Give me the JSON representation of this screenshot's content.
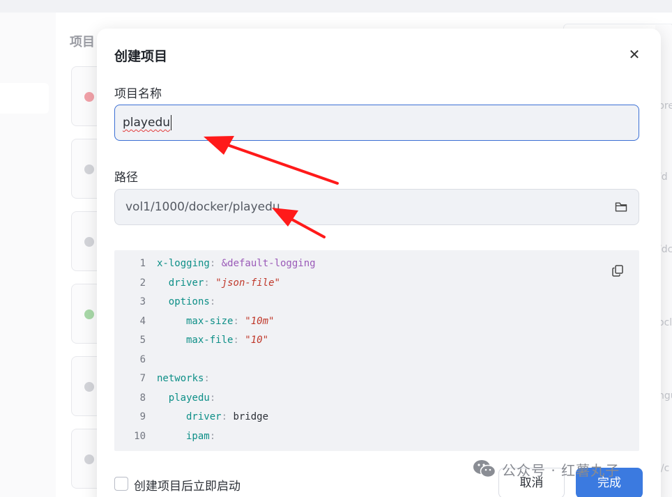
{
  "background": {
    "page_title": "项目",
    "peek_texts": [
      "pre",
      "/d",
      "/dc",
      "ocl",
      "ngu",
      "l/c"
    ]
  },
  "dialog": {
    "title": "创建项目",
    "close_icon": "close-icon",
    "name_label": "项目名称",
    "name_value": "playedu",
    "path_label": "路径",
    "path_value": "vol1/1000/docker/playedu",
    "folder_icon": "folder-icon",
    "copy_icon": "copy-icon",
    "code_lines": [
      {
        "n": "1",
        "key": "x-logging",
        "punct": ": ",
        "val": "&default-logging",
        "type": "anchor",
        "indent": 0
      },
      {
        "n": "2",
        "key": "driver",
        "punct": ": ",
        "val": "\"json-file\"",
        "type": "string",
        "indent": 2
      },
      {
        "n": "3",
        "key": "options",
        "punct": ":",
        "val": "",
        "type": "none",
        "indent": 2
      },
      {
        "n": "4",
        "key": "max-size",
        "punct": ": ",
        "val": "\"10m\"",
        "type": "string",
        "indent": 5
      },
      {
        "n": "5",
        "key": "max-file",
        "punct": ": ",
        "val": "\"10\"",
        "type": "string",
        "indent": 5
      },
      {
        "n": "6",
        "key": "",
        "punct": "",
        "val": "",
        "type": "none",
        "indent": 0
      },
      {
        "n": "7",
        "key": "networks",
        "punct": ":",
        "val": "",
        "type": "none",
        "indent": 0
      },
      {
        "n": "8",
        "key": "playedu",
        "punct": ":",
        "val": "",
        "type": "none",
        "indent": 2
      },
      {
        "n": "9",
        "key": "driver",
        "punct": ": ",
        "val": "bridge",
        "type": "plain",
        "indent": 5
      },
      {
        "n": "10",
        "key": "ipam",
        "punct": ":",
        "val": "",
        "type": "none",
        "indent": 5
      }
    ],
    "start_after_create_label": "创建项目后立即启动",
    "start_after_create_checked": false,
    "cancel_label": "取消",
    "done_label": "完成",
    "accent_color": "#3b7ae0"
  },
  "watermark": {
    "text": "公众号 · 红薯丸子",
    "icon": "wechat-icon"
  }
}
